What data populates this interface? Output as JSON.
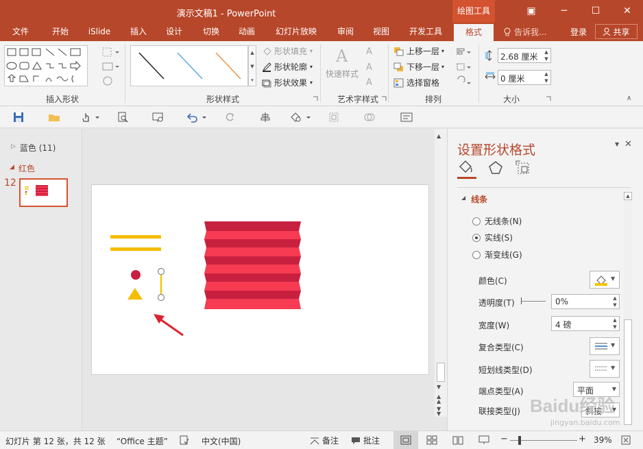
{
  "app": {
    "title": "演示文稿1 - PowerPoint",
    "context_tab_label": "绘图工具",
    "accent": "#b7472a",
    "accent_light": "#d35230"
  },
  "window_controls": {
    "ribbon_display": "▣",
    "minimize": "─",
    "restore": "☐",
    "close": "✕"
  },
  "tabs": [
    "文件",
    "开始",
    "iSlide",
    "插入",
    "设计",
    "切换",
    "动画",
    "幻灯片放映",
    "审阅",
    "视图",
    "开发工具",
    "格式"
  ],
  "active_tab": "格式",
  "tell_me": "告诉我...",
  "account": {
    "login": "登录",
    "share": "共享"
  },
  "ribbon": {
    "groups": {
      "insert_shapes": "插入形状",
      "shape_styles": "形状样式",
      "wordart_styles": "艺术字样式",
      "arrange": "排列",
      "size": "大小"
    },
    "shape_fill": "形状填充",
    "shape_outline": "形状轮廓",
    "shape_effects": "形状效果",
    "quick_styles": "快速样式",
    "bring_forward": "上移一层",
    "send_backward": "下移一层",
    "selection_pane": "选择窗格",
    "height_value": "2.68 厘米",
    "width_value": "0 厘米"
  },
  "thumbnails": {
    "sections": [
      {
        "label": "蓝色 (11)",
        "expanded": false
      },
      {
        "label": "红色",
        "expanded": true
      }
    ],
    "current_slide_number": "12"
  },
  "format_pane": {
    "title": "设置形状格式",
    "section": "线条",
    "line_options": [
      {
        "label": "无线条(N)",
        "selected": false
      },
      {
        "label": "实线(S)",
        "selected": true
      },
      {
        "label": "渐变线(G)",
        "selected": false
      }
    ],
    "color_label": "颜色(C)",
    "transparency_label": "透明度(T)",
    "transparency_value": "0%",
    "width_label": "宽度(W)",
    "width_value": "4 磅",
    "compound_label": "复合类型(C)",
    "dash_label": "短划线类型(D)",
    "cap_label": "端点类型(A)",
    "cap_value": "平面",
    "join_label": "联接类型(J)",
    "join_value": "斜接",
    "line_color": "#f5c400"
  },
  "slide_colors": {
    "yellow": "#f5bd00",
    "dark_red": "#c8203f",
    "light_red": "#f63b52",
    "arrow": "#e02030"
  },
  "status": {
    "slide_info": "幻灯片 第 12 张，共 12 张",
    "theme": "“Office 主题”",
    "language": "中文(中国)",
    "notes": "备注",
    "comments": "批注",
    "zoom": "39%"
  },
  "watermark": {
    "brand": "Baidu经验",
    "url": "jingyan.baidu.com"
  }
}
